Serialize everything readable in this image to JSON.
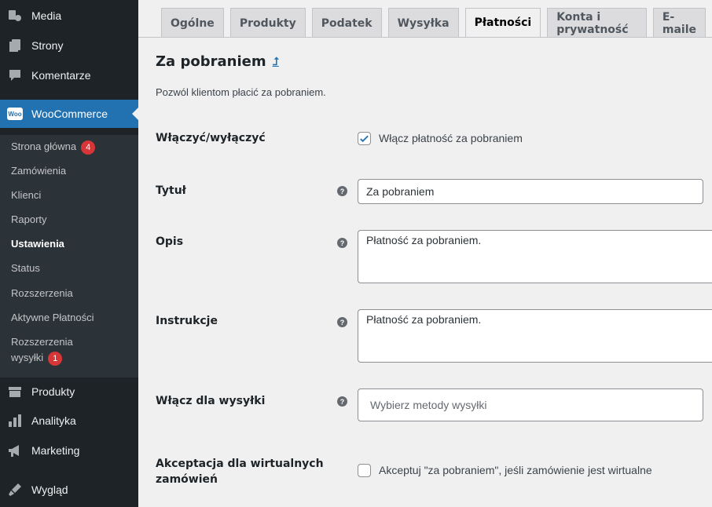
{
  "sidebar": {
    "top_items": [
      {
        "label": "Media",
        "icon": "media-icon"
      },
      {
        "label": "Strony",
        "icon": "pages-icon"
      },
      {
        "label": "Komentarze",
        "icon": "comments-icon"
      }
    ],
    "woocommerce": {
      "label": "WooCommerce",
      "logo_text": "Woo"
    },
    "submenu": [
      {
        "label": "Strona główna",
        "badge": "4"
      },
      {
        "label": "Zamówienia"
      },
      {
        "label": "Klienci"
      },
      {
        "label": "Raporty"
      },
      {
        "label": "Ustawienia"
      },
      {
        "label": "Status"
      },
      {
        "label": "Rozszerzenia"
      },
      {
        "label": "Aktywne Płatności"
      },
      {
        "label": "Rozszerzenia",
        "label2": "wysyłki",
        "badge": "1"
      }
    ],
    "bottom_items": [
      {
        "label": "Produkty",
        "icon": "products-icon"
      },
      {
        "label": "Analityka",
        "icon": "analytics-icon"
      },
      {
        "label": "Marketing",
        "icon": "megaphone-icon"
      },
      {
        "label": "Wygląd",
        "icon": "appearance-icon"
      }
    ]
  },
  "tabs": [
    "Ogólne",
    "Produkty",
    "Podatek",
    "Wysyłka",
    "Płatności",
    "Konta i prywatność",
    "E-maile"
  ],
  "active_tab": "Płatności",
  "section": {
    "title": "Za pobraniem",
    "back_link": "⮥",
    "description": "Pozwól klientom płacić za pobraniem."
  },
  "fields": {
    "enable": {
      "label": "Włączyć/wyłączyć",
      "checkbox_label": "Włącz płatność za pobraniem",
      "checked": true
    },
    "title": {
      "label": "Tytuł",
      "value": "Za pobraniem"
    },
    "description": {
      "label": "Opis",
      "value": "Płatność za pobraniem."
    },
    "instructions": {
      "label": "Instrukcje",
      "value": "Płatność za pobraniem."
    },
    "shipping": {
      "label": "Włącz dla wysyłki",
      "placeholder": "Wybierz metody wysyłki"
    },
    "virtual": {
      "label_line1": "Akceptacja dla wirtualnych",
      "label_line2": "zamówień",
      "checkbox_label": "Akceptuj \"za pobraniem\", jeśli zamówienie jest wirtualne",
      "checked": false
    }
  },
  "colors": {
    "accent": "#2271b1",
    "sidebar": "#1d2327",
    "badge": "#d63638"
  }
}
